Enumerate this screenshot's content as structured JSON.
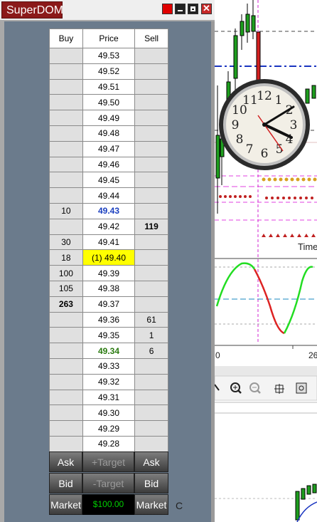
{
  "window": {
    "title": "SuperDOM",
    "close_glyph": "✕"
  },
  "ladder": {
    "headers": {
      "buy": "Buy",
      "price": "Price",
      "sell": "Sell"
    },
    "rows": [
      {
        "buy": "",
        "price": "49.53",
        "sell": ""
      },
      {
        "buy": "",
        "price": "49.52",
        "sell": ""
      },
      {
        "buy": "",
        "price": "49.51",
        "sell": ""
      },
      {
        "buy": "",
        "price": "49.50",
        "sell": ""
      },
      {
        "buy": "",
        "price": "49.49",
        "sell": ""
      },
      {
        "buy": "",
        "price": "49.48",
        "sell": ""
      },
      {
        "buy": "",
        "price": "49.47",
        "sell": ""
      },
      {
        "buy": "",
        "price": "49.46",
        "sell": ""
      },
      {
        "buy": "",
        "price": "49.45",
        "sell": ""
      },
      {
        "buy": "",
        "price": "49.44",
        "sell": ""
      },
      {
        "buy": "10",
        "price": "49.43",
        "sell": "",
        "style": "blue"
      },
      {
        "buy": "",
        "price": "49.42",
        "sell": "119",
        "sell_bold": true
      },
      {
        "buy": "30",
        "price": "49.41",
        "sell": ""
      },
      {
        "buy": "18",
        "price": "(1) 49.40",
        "sell": "",
        "style": "yellow"
      },
      {
        "buy": "100",
        "price": "49.39",
        "sell": ""
      },
      {
        "buy": "105",
        "price": "49.38",
        "sell": ""
      },
      {
        "buy": "263",
        "price": "49.37",
        "sell": "",
        "buy_bold": true
      },
      {
        "buy": "",
        "price": "49.36",
        "sell": "61"
      },
      {
        "buy": "",
        "price": "49.35",
        "sell": "1"
      },
      {
        "buy": "",
        "price": "49.34",
        "sell": "6",
        "style": "green"
      },
      {
        "buy": "",
        "price": "49.33",
        "sell": ""
      },
      {
        "buy": "",
        "price": "49.32",
        "sell": ""
      },
      {
        "buy": "",
        "price": "49.31",
        "sell": ""
      },
      {
        "buy": "",
        "price": "49.30",
        "sell": ""
      },
      {
        "buy": "",
        "price": "49.29",
        "sell": ""
      },
      {
        "buy": "",
        "price": "49.28",
        "sell": ""
      }
    ]
  },
  "buttons": {
    "row1": {
      "left": "Ask",
      "mid": "+Target",
      "right": "Ask"
    },
    "row2": {
      "left": "Bid",
      "mid": "-Target",
      "right": "Bid"
    },
    "row3": {
      "left": "Market",
      "pnl": "$100.00",
      "right": "Market"
    },
    "trailing_label": "C"
  },
  "chart": {
    "time_label": "Time",
    "x_axis_labels": [
      "0",
      "26"
    ],
    "clock_numerals": [
      "12",
      "1",
      "2",
      "3",
      "4",
      "5",
      "6",
      "7",
      "8",
      "9",
      "10",
      "11"
    ]
  },
  "colors": {
    "title_bg": "#8b1a1a",
    "panel_bg": "#6b7b8c",
    "highlight": "#ffff00",
    "pnl_text": "#00d000"
  }
}
